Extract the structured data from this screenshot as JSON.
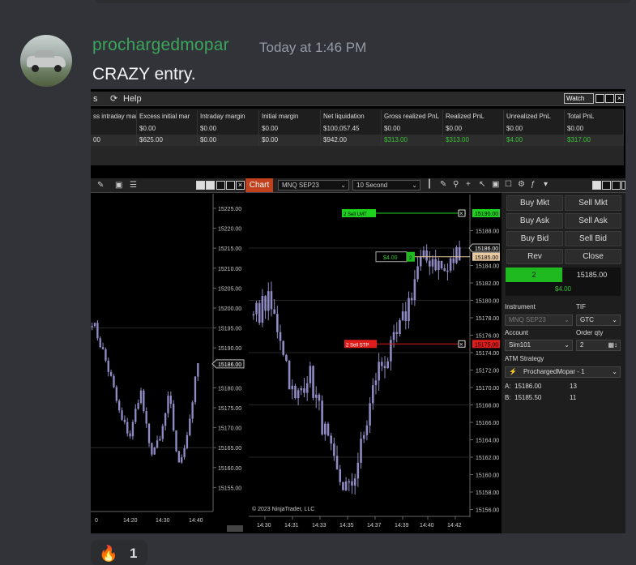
{
  "message": {
    "username": "prochargedmopar",
    "timestamp": "Today at 1:46 PM",
    "text": "CRAZY entry.",
    "reaction": {
      "emoji": "🔥",
      "count": "1"
    }
  },
  "app": {
    "menu_partial": "s",
    "help_label": "Help",
    "watch_label": "Watch"
  },
  "accounts_grid": {
    "columns": [
      "ss intraday mar",
      "Excess initial mar",
      "Intraday margin",
      "Initial margin",
      "Net liquidation",
      "Gross realized PnL",
      "Realized PnL",
      "Unrealized PnL",
      "Total PnL"
    ],
    "rows": [
      [
        "",
        "$0.00",
        "$0.00",
        "$0.00",
        "$100,057.45",
        "$0.00",
        "$0.00",
        "$0.00",
        "$0.00"
      ],
      [
        "00",
        "$625.00",
        "$0.00",
        "$0.00",
        "$942.00",
        "$313.00",
        "$313.00",
        "$4.00",
        "$317.00"
      ]
    ]
  },
  "left_chart": {
    "price_labels": [
      "15225.00",
      "15220.00",
      "15215.00",
      "15210.00",
      "15205.00",
      "15200.00",
      "15195.00",
      "15190.00",
      "15186.00",
      "15180.00",
      "15175.00",
      "15170.00",
      "15165.00",
      "15160.00",
      "15155.00"
    ],
    "time_labels": [
      "0",
      "14:20",
      "14:30",
      "14:40"
    ]
  },
  "main_chart": {
    "tab_label": "Chart",
    "instrument": "MNQ SEP23",
    "interval": "10 Second",
    "copyright": "© 2023 NinjaTrader, LLC",
    "sell_lmt_label": "2  Sell LMT",
    "sell_stp_label": "2  Sell STP",
    "pnl_box": "$4.00",
    "pnl_qty": "2",
    "price_labels": [
      "15190.00",
      "15188.00",
      "15186.00",
      "15185.00",
      "15184.00",
      "15182.00",
      "15180.00",
      "15178.00",
      "15176.00",
      "15175.00",
      "15174.00",
      "15172.00",
      "15170.00",
      "15168.00",
      "15166.00",
      "15164.00",
      "15162.00",
      "15160.00",
      "15158.00",
      "15156.00"
    ],
    "time_labels": [
      "14:30",
      "14:31",
      "14:33",
      "14:35",
      "14:37",
      "14:39",
      "14:40",
      "14:42"
    ]
  },
  "order_panel": {
    "buy_mkt": "Buy Mkt",
    "sell_mkt": "Sell Mkt",
    "buy_ask": "Buy Ask",
    "sell_ask": "Sell Ask",
    "buy_bid": "Buy Bid",
    "sell_bid": "Sell Bid",
    "rev": "Rev",
    "close": "Close",
    "position_qty": "2",
    "position_price": "15185.00",
    "position_pnl": "$4.00",
    "instrument_label": "Instrument",
    "instrument_value": "MNQ SEP23",
    "tif_label": "TIF",
    "tif_value": "GTC",
    "account_label": "Account",
    "account_value": "Sim101",
    "qty_label": "Order qty",
    "qty_value": "2",
    "atm_label": "ATM Strategy",
    "atm_value": "ProchargedMopar - 1",
    "ask_label": "A:",
    "ask_price": "15186.00",
    "ask_size": "13",
    "bid_label": "B:",
    "bid_price": "15185.50",
    "bid_size": "11"
  },
  "colors": {
    "username": "#3ba55c",
    "candle": "#8f8bc4",
    "sell_lmt": "#1fd11f",
    "sell_stp": "#e01d1d",
    "chart_tab": "#c2401c",
    "position_green": "#1fba1f",
    "pnl_green": "#39c039"
  }
}
